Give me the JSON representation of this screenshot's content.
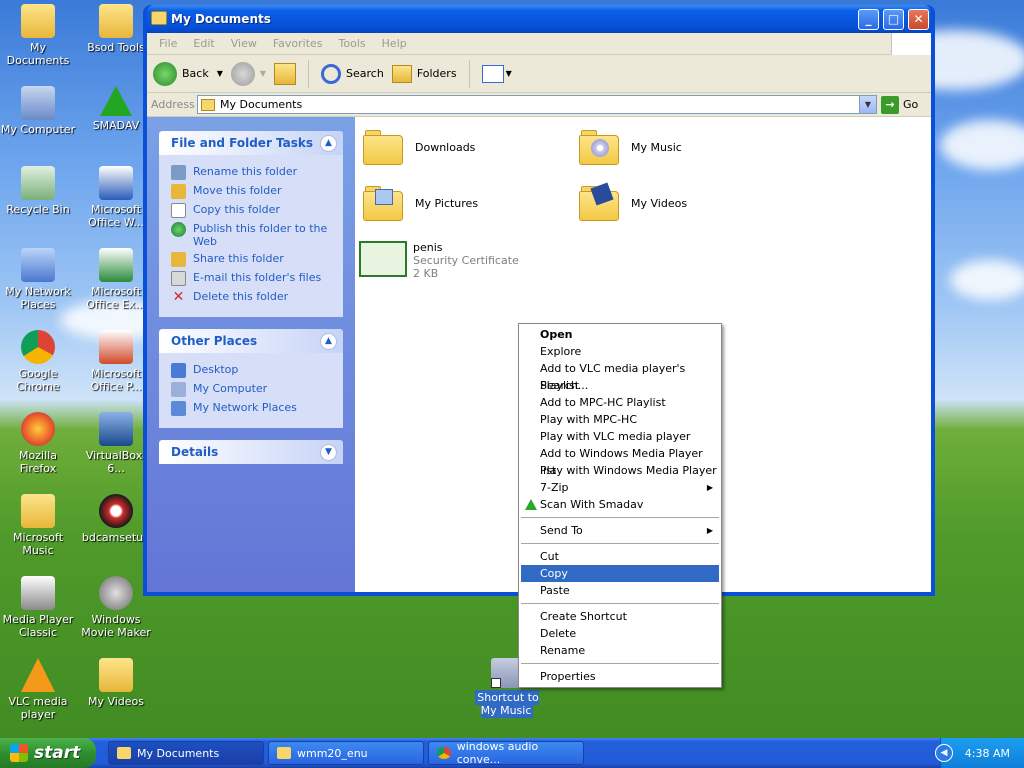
{
  "desktop": {
    "icons": [
      {
        "label": "My Documents"
      },
      {
        "label": "Bsod Tools"
      },
      {
        "label": "My Computer"
      },
      {
        "label": "SMADAV"
      },
      {
        "label": "Recycle Bin"
      },
      {
        "label": "Microsoft Office W..."
      },
      {
        "label": "My Network Places"
      },
      {
        "label": "Microsoft Office Ex..."
      },
      {
        "label": "Google Chrome"
      },
      {
        "label": "Microsoft Office P..."
      },
      {
        "label": "Mozilla Firefox"
      },
      {
        "label": "VirtualBox-6..."
      },
      {
        "label": "Microsoft Music"
      },
      {
        "label": "bdcamsetup"
      },
      {
        "label": "Media Player Classic"
      },
      {
        "label": "Windows Movie Maker"
      },
      {
        "label": "VLC media player"
      },
      {
        "label": "My Videos"
      }
    ],
    "selected_shortcut": "Shortcut to My Music"
  },
  "window": {
    "title": "My Documents",
    "menu": [
      "File",
      "Edit",
      "View",
      "Favorites",
      "Tools",
      "Help"
    ],
    "toolbar": {
      "back": "Back",
      "search": "Search",
      "folders": "Folders"
    },
    "address": {
      "label": "Address",
      "value": "My Documents",
      "go": "Go"
    },
    "panels": {
      "tasks": {
        "title": "File and Folder Tasks",
        "items": [
          "Rename this folder",
          "Move this folder",
          "Copy this folder",
          "Publish this folder to the Web",
          "Share this folder",
          "E-mail this folder's files",
          "Delete this folder"
        ]
      },
      "places": {
        "title": "Other Places",
        "items": [
          "Desktop",
          "My Computer",
          "My Network Places"
        ]
      },
      "details": {
        "title": "Details"
      }
    },
    "files": [
      {
        "name": "Downloads"
      },
      {
        "name": "My Music"
      },
      {
        "name": "My Pictures"
      },
      {
        "name": "My Videos"
      },
      {
        "name": "penis",
        "type": "Security Certificate",
        "size": "2 KB"
      }
    ]
  },
  "context_menu": {
    "items": [
      "Open",
      "Explore",
      "Add to VLC media player's Playlist",
      "Search...",
      "Add to MPC-HC Playlist",
      "Play with MPC-HC",
      "Play with VLC media player",
      "Add to Windows Media Player list",
      "Play with Windows Media Player",
      "7-Zip",
      "Scan With Smadav",
      "Send To",
      "Cut",
      "Copy",
      "Paste",
      "Create Shortcut",
      "Delete",
      "Rename",
      "Properties"
    ],
    "highlighted": "Copy"
  },
  "taskbar": {
    "start": "start",
    "tasks": [
      "My Documents",
      "wmm20_enu",
      "windows audio conve..."
    ],
    "clock": "4:38 AM"
  },
  "colors": {
    "selection": "#316ac5",
    "link": "#215dc6",
    "title_blue": "#0550d6"
  }
}
